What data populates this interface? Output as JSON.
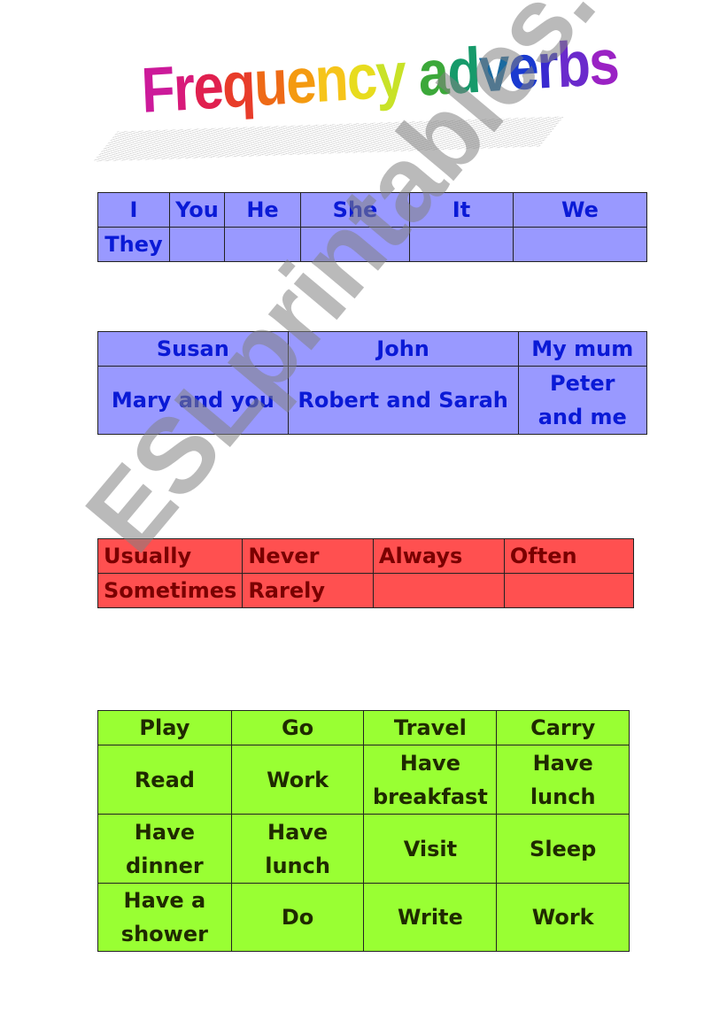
{
  "title": {
    "words": [
      "Frequency",
      "adverbs"
    ],
    "letters": [
      "F",
      "r",
      "e",
      "q",
      "u",
      "e",
      "n",
      "c",
      "y",
      " ",
      "a",
      "d",
      "v",
      "e",
      "r",
      "b",
      "s"
    ],
    "letter_colors": [
      "#cc1a9a",
      "#d81a7a",
      "#e0204f",
      "#e83c2a",
      "#ee6a16",
      "#f49a10",
      "#f6c41a",
      "#e8dc1e",
      "#c8e228",
      "#ffffff",
      "#3ca83a",
      "#169a6a",
      "#1a6aa0",
      "#1a3ad0",
      "#3a2ad0",
      "#6a2acc",
      "#9a22c4"
    ]
  },
  "pronouns_table": {
    "color": "#9999ff",
    "text_color": "#0a1ad6",
    "rows": [
      [
        "I",
        "You",
        "He",
        "She",
        "It",
        "We"
      ],
      [
        "They",
        "",
        "",
        "",
        "",
        ""
      ]
    ]
  },
  "names_table": {
    "color": "#9999ff",
    "text_color": "#0a1ad6",
    "rows": [
      [
        "Susan",
        "John",
        "My mum"
      ],
      [
        "Mary and you",
        "Robert and Sarah",
        "Peter and me"
      ]
    ]
  },
  "adverbs_table": {
    "color": "#ff5050",
    "text_color": "#7a0000",
    "rows": [
      [
        "Usually",
        "Never",
        "Always",
        "Often"
      ],
      [
        "Sometimes",
        "Rarely",
        "",
        ""
      ]
    ]
  },
  "verbs_table": {
    "color": "#99ff33",
    "text_color": "#1f2a00",
    "rows": [
      [
        "Play",
        "Go",
        "Travel",
        "Carry"
      ],
      [
        "Read",
        "Work",
        "Have breakfast",
        "Have lunch"
      ],
      [
        "Have dinner",
        "Have lunch",
        "Visit",
        "Sleep"
      ],
      [
        "Have a shower",
        "Do",
        "Write",
        "Work"
      ]
    ]
  },
  "watermark": "ESLprintables.com"
}
